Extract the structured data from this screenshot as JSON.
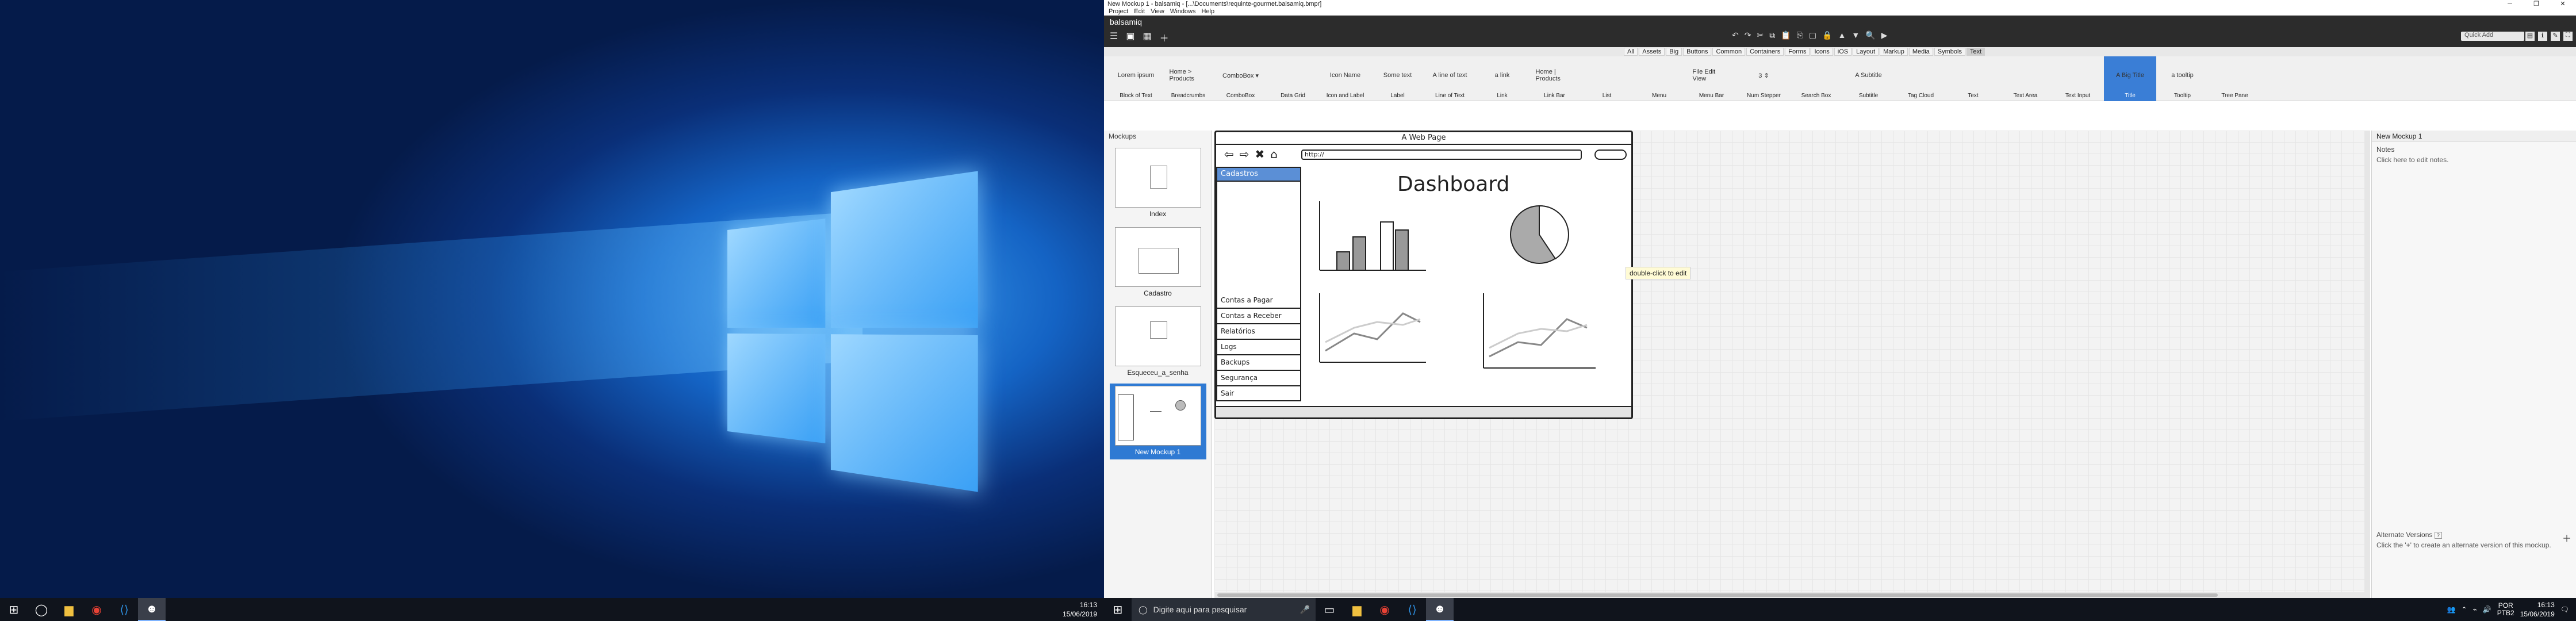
{
  "desktop": {
    "taskbar_left": {
      "icons": [
        "windows-start",
        "cortana-search",
        "file-explorer",
        "chrome",
        "vscode",
        "balsamiq"
      ],
      "time": "16:13",
      "date": "15/06/2019"
    },
    "taskbar_right": {
      "search_placeholder": "Digite aqui para pesquisar",
      "lang": "POR",
      "lang2": "PTB2",
      "time": "16:13",
      "date": "15/06/2019"
    }
  },
  "app": {
    "window_title": "New Mockup 1 - balsamiq - [...\\Documents\\requinte-gourmet.balsamiq.bmpr]",
    "menus": [
      "Project",
      "Edit",
      "View",
      "Windows",
      "Help"
    ],
    "brand": "balsamiq",
    "quick_add_placeholder": "Quick Add",
    "categories": [
      "All",
      "Assets",
      "Big",
      "Buttons",
      "Common",
      "Containers",
      "Forms",
      "Icons",
      "iOS",
      "Layout",
      "Markup",
      "Media",
      "Symbols",
      "Text"
    ],
    "selected_category": "Text",
    "library": [
      {
        "label": "Block of Text",
        "preview": "Lorem ipsum"
      },
      {
        "label": "Breadcrumbs",
        "preview": "Home > Products"
      },
      {
        "label": "ComboBox",
        "preview": "ComboBox ▾"
      },
      {
        "label": "Data Grid",
        "preview": ""
      },
      {
        "label": "Icon and Label",
        "preview": "Icon Name"
      },
      {
        "label": "Label",
        "preview": "Some text"
      },
      {
        "label": "Line of Text",
        "preview": "A line of text"
      },
      {
        "label": "Link",
        "preview": "a link"
      },
      {
        "label": "Link Bar",
        "preview": "Home | Products"
      },
      {
        "label": "List",
        "preview": ""
      },
      {
        "label": "Menu",
        "preview": ""
      },
      {
        "label": "Menu Bar",
        "preview": "File Edit View"
      },
      {
        "label": "Num Stepper",
        "preview": "3 ⇕"
      },
      {
        "label": "Search Box",
        "preview": ""
      },
      {
        "label": "Subtitle",
        "preview": "A Subtitle"
      },
      {
        "label": "Tag Cloud",
        "preview": ""
      },
      {
        "label": "Text",
        "preview": ""
      },
      {
        "label": "Text Area",
        "preview": ""
      },
      {
        "label": "Text Input",
        "preview": ""
      },
      {
        "label": "Title",
        "preview": "A Big Title"
      },
      {
        "label": "Tooltip",
        "preview": "a tooltip"
      },
      {
        "label": "Tree Pane",
        "preview": ""
      }
    ],
    "selected_library": "Title",
    "navigator": {
      "header": "Mockups",
      "items": [
        {
          "label": "Index"
        },
        {
          "label": "Cadastro"
        },
        {
          "label": "Esqueceu_a_senha"
        },
        {
          "label": "New Mockup 1"
        }
      ],
      "selected": "New Mockup 1"
    },
    "mockup": {
      "window_title": "A Web Page",
      "address": "http://",
      "sidebar_header": "Cadastros",
      "menu_items": [
        "Contas a Pagar",
        "Contas a Receber",
        "Relatórios",
        "Logs",
        "Backups",
        "Segurança",
        "Sair"
      ],
      "title": "Dashboard"
    },
    "tooltip": "double-click to edit",
    "properties": {
      "header": "New Mockup 1",
      "notes_label": "Notes",
      "notes_hint": "Click here to edit notes.",
      "alt_label": "Alternate Versions",
      "alt_hint": "Click the '+' to create an alternate version of this mockup."
    }
  }
}
